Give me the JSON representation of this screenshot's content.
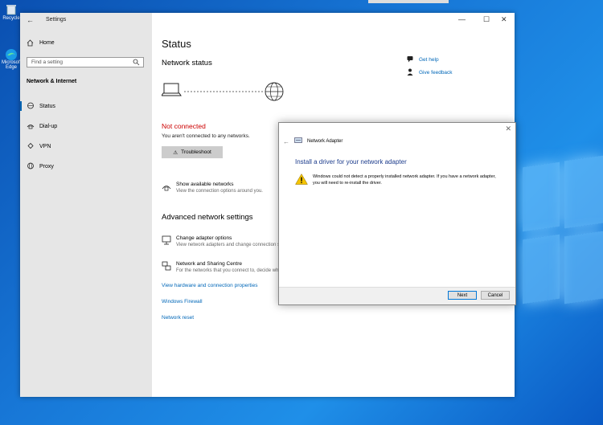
{
  "desktop": {
    "recycle_label": "Recycle",
    "edge_label": "Microsoft Edge"
  },
  "window": {
    "title": "Settings",
    "minimize": "—",
    "maximize": "☐",
    "close": "✕",
    "back": "←"
  },
  "sidebar": {
    "home": "Home",
    "search_placeholder": "Find a setting",
    "section": "Network & Internet",
    "items": [
      {
        "label": "Status",
        "icon": "status-icon"
      },
      {
        "label": "Dial-up",
        "icon": "dialup-icon"
      },
      {
        "label": "VPN",
        "icon": "vpn-icon"
      },
      {
        "label": "Proxy",
        "icon": "proxy-icon"
      }
    ]
  },
  "main": {
    "title": "Status",
    "network_status": "Network status",
    "state": "Not connected",
    "state_detail": "You aren't connected to any networks.",
    "troubleshoot": "Troubleshoot",
    "show_networks": {
      "title": "Show available networks",
      "desc": "View the connection options around you."
    },
    "advanced_title": "Advanced network settings",
    "change_adapter": {
      "title": "Change adapter options",
      "desc": "View network adapters and change connection settings."
    },
    "sharing_centre": {
      "title": "Network and Sharing Centre",
      "desc": "For the networks that you connect to, decide what you want to share."
    },
    "links": [
      "View hardware and connection properties",
      "Windows Firewall",
      "Network reset"
    ],
    "help": {
      "get_help": "Get help",
      "feedback": "Give feedback"
    }
  },
  "dialog": {
    "title": "Network Adapter",
    "heading": "Install a driver for your network adapter",
    "message": "Windows could not detect a properly installed network adapter. If you have a network adapter, you will need to re-install the driver.",
    "next": "Next",
    "cancel": "Cancel",
    "close": "✕"
  },
  "colors": {
    "accent": "#0067b8",
    "error": "#cc0000",
    "sidebar_bg": "#e6e6e6"
  }
}
